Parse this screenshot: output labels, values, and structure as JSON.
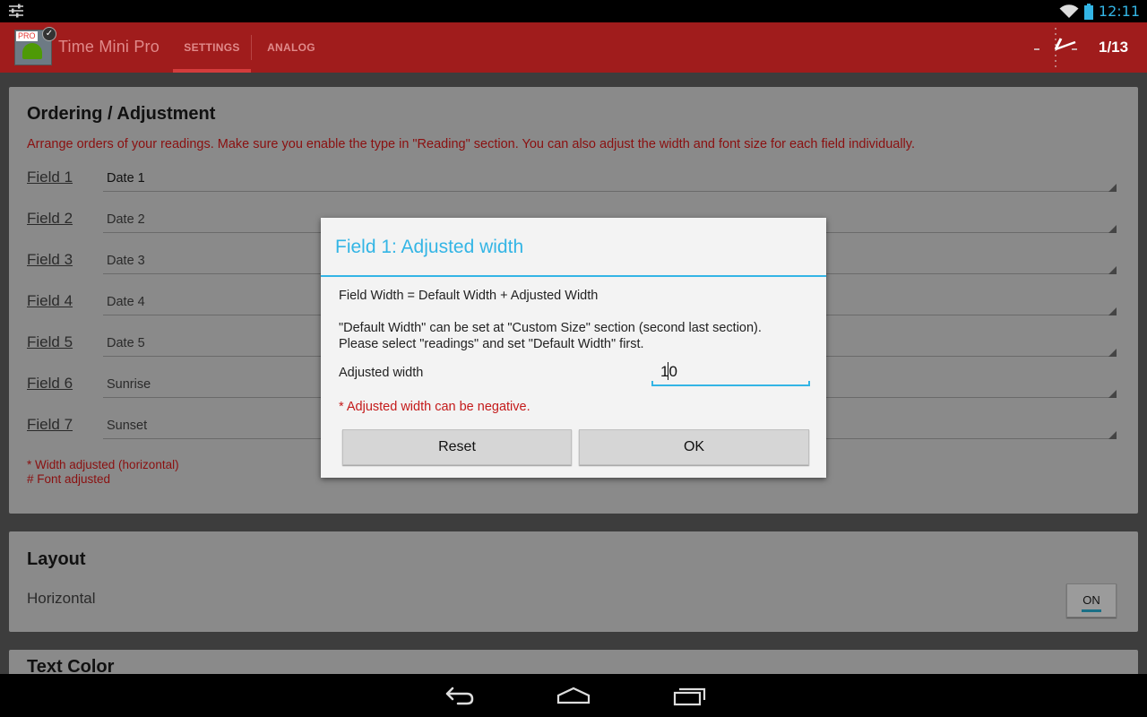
{
  "status_bar": {
    "time": "12:11"
  },
  "action_bar": {
    "logo_badge": "PRO",
    "app_title": "Time Mini Pro",
    "tabs": [
      {
        "label": "SETTINGS",
        "selected": true
      },
      {
        "label": "ANALOG",
        "selected": false
      }
    ],
    "page_indicator": "1/13"
  },
  "ordering_card": {
    "title": "Ordering / Adjustment",
    "description": "Arrange orders of your readings. Make sure you enable the type in \"Reading\" section. You can also adjust the width and font size for each field individually.",
    "fields": [
      {
        "label": "Field 1",
        "value": "Date 1"
      },
      {
        "label": "Field 2",
        "value": "Date 2"
      },
      {
        "label": "Field 3",
        "value": "Date 3"
      },
      {
        "label": "Field 4",
        "value": "Date 4"
      },
      {
        "label": "Field 5",
        "value": "Date 5"
      },
      {
        "label": "Field 6",
        "value": "Sunrise"
      },
      {
        "label": "Field 7",
        "value": "Sunset"
      }
    ],
    "note_width": "* Width adjusted (horizontal)",
    "note_font": "# Font adjusted"
  },
  "layout_card": {
    "title": "Layout",
    "label": "Horizontal",
    "toggle": "ON"
  },
  "next_card": {
    "title": "Text Color"
  },
  "dialog": {
    "title": "Field 1: Adjusted width",
    "formula": "Field Width = Default Width + Adjusted Width",
    "info_line1": "\"Default Width\" can be set at \"Custom Size\" section (second last section).",
    "info_line2": "Please select \"readings\" and set \"Default Width\" first.",
    "input_label": "Adjusted width",
    "input_value": "10",
    "warning": "* Adjusted width can be negative.",
    "reset_label": "Reset",
    "ok_label": "OK"
  },
  "colors": {
    "action_bar": "#a01c1c",
    "accent": "#33b5e5",
    "warning": "#c41a1a"
  },
  "icons": [
    "settings-sliders-icon",
    "wifi-icon",
    "battery-icon",
    "app-logo",
    "analog-clock-icon",
    "back-icon",
    "home-icon",
    "recents-icon"
  ]
}
